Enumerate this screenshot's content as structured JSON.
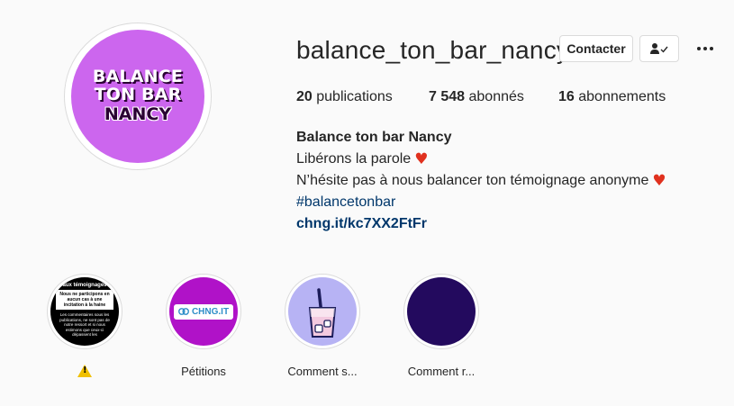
{
  "profile": {
    "avatar_lines": [
      "BALANCE",
      "TON BAR",
      "NANCY"
    ],
    "username": "balance_ton_bar_nancy",
    "contact_label": "Contacter",
    "follow_icon": "person-check-icon",
    "more_icon": "more-icon"
  },
  "stats": {
    "posts_count": "20",
    "posts_label": "publications",
    "followers_count": "7 548",
    "followers_label": "abonnés",
    "following_count": "16",
    "following_label": "abonnements"
  },
  "bio": {
    "name": "Balance ton bar Nancy",
    "line1": "Libérons la parole",
    "line2": "N’hésite pas à nous balancer ton témoignage anonyme",
    "hashtag": "#balancetonbar",
    "link": "chng.it/kc7XX2FtFr",
    "heart_color": "#e0311e"
  },
  "highlights": [
    {
      "label": "",
      "icon": "warning-icon",
      "cover": {
        "title": "aux témoignages",
        "box": "Nous ne participons en aucun cas à une incitation à la haine",
        "small": "Les commentaires sous les publications, ne sont pas de notre ressort et si nous estimons que ceux-ci dépassent les"
      }
    },
    {
      "label": "Pétitions",
      "cover": {
        "pill": "CHNG.IT"
      }
    },
    {
      "label": "Comment s..."
    },
    {
      "label": "Comment r..."
    }
  ]
}
